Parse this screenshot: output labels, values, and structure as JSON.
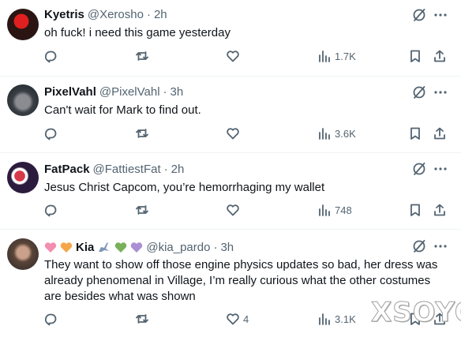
{
  "tweets": [
    {
      "name": "Kyetris",
      "handle": "@Xerosho",
      "dot": "·",
      "time": "2h",
      "text": "oh fuck! i need this game yesterday",
      "likes": "",
      "views": "1.7K"
    },
    {
      "name": "PixelVahl",
      "handle": "@PixelVahl",
      "dot": "·",
      "time": "3h",
      "text": "Can't wait for Mark to find out.",
      "likes": "",
      "views": "3.6K"
    },
    {
      "name": "FatPack",
      "handle": "@FattiestFat",
      "dot": "·",
      "time": "2h",
      "text": "Jesus Christ Capcom, you’re hemorrhaging my wallet",
      "likes": "",
      "views": "748"
    },
    {
      "name": "Kia",
      "handle": "@kia_pardo",
      "dot": "·",
      "time": "3h",
      "text": "They want to show off those engine physics updates so bad, her dress was already phenomenal in Village, I’m really curious what the other costumes are besides what was shown",
      "likes": "4",
      "views": "3.1K"
    }
  ],
  "icons": {
    "reply": "reply-icon",
    "retweet": "retweet-icon",
    "like": "heart-icon",
    "views": "views-icon",
    "bookmark": "bookmark-icon",
    "share": "share-icon",
    "grok": "grok-icon",
    "more": "more-icon"
  },
  "watermark": "XSOYO",
  "colors": {
    "text": "#0f1419",
    "secondary": "#536471",
    "divider": "#eff3f4"
  }
}
